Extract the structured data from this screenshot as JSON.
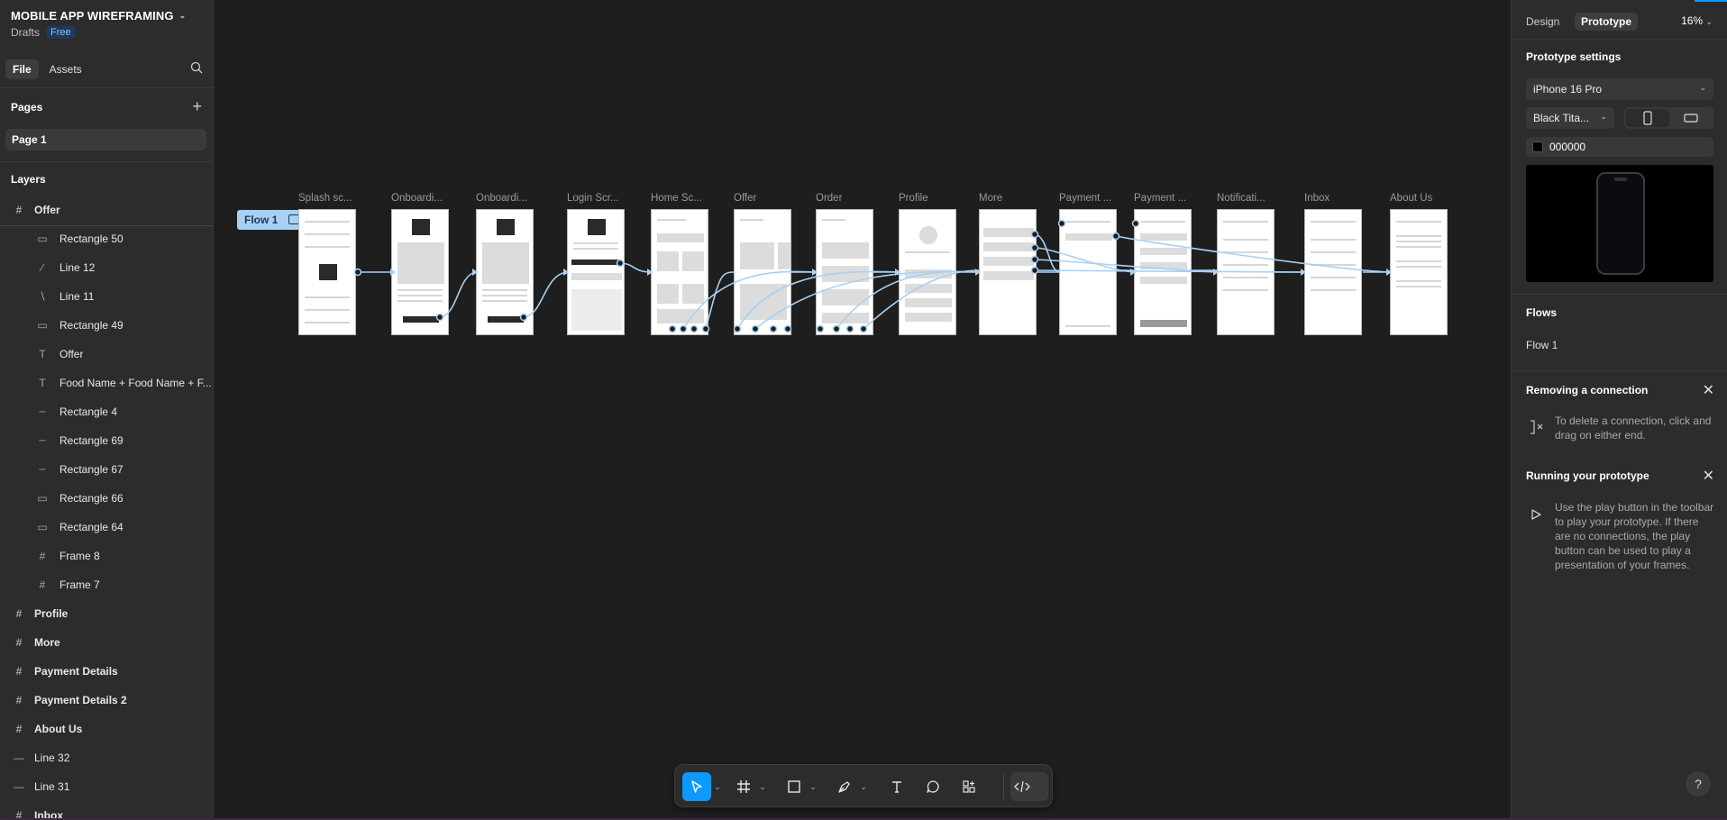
{
  "file": {
    "title": "MOBILE APP WIREFRAMING",
    "location": "Drafts",
    "plan": "Free"
  },
  "left_tabs": {
    "file": "File",
    "assets": "Assets"
  },
  "pages": {
    "title": "Pages",
    "items": [
      "Page 1"
    ]
  },
  "layers": {
    "title": "Layers",
    "items": [
      {
        "type": "frame",
        "level": 0,
        "label": "Offer"
      },
      {
        "type": "rect-dash",
        "level": 1,
        "label": "Rectangle 50"
      },
      {
        "type": "line",
        "level": 1,
        "label": "Line 12"
      },
      {
        "type": "line",
        "level": 1,
        "label": "Line 11"
      },
      {
        "type": "rect",
        "level": 1,
        "label": "Rectangle 49"
      },
      {
        "type": "text",
        "level": 1,
        "label": "Offer"
      },
      {
        "type": "text",
        "level": 1,
        "label": "Food Name + Food Name + F..."
      },
      {
        "type": "rect-dash",
        "level": 1,
        "label": "Rectangle 4"
      },
      {
        "type": "rect-dash",
        "level": 1,
        "label": "Rectangle 69"
      },
      {
        "type": "rect-dash",
        "level": 1,
        "label": "Rectangle 67"
      },
      {
        "type": "rect",
        "level": 1,
        "label": "Rectangle 66"
      },
      {
        "type": "rect",
        "level": 1,
        "label": "Rectangle 64"
      },
      {
        "type": "frame",
        "level": 1,
        "label": "Frame 8"
      },
      {
        "type": "frame",
        "level": 1,
        "label": "Frame 7"
      },
      {
        "type": "frame",
        "level": 0,
        "label": "Profile"
      },
      {
        "type": "frame",
        "level": 0,
        "label": "More"
      },
      {
        "type": "frame",
        "level": 0,
        "label": "Payment Details"
      },
      {
        "type": "frame",
        "level": 0,
        "label": "Payment Details 2"
      },
      {
        "type": "frame",
        "level": 0,
        "label": "About Us"
      },
      {
        "type": "line",
        "level": 0,
        "label": "Line 32"
      },
      {
        "type": "line",
        "level": 0,
        "label": "Line 31"
      },
      {
        "type": "frame",
        "level": 0,
        "label": "Inbox"
      }
    ]
  },
  "canvas": {
    "flow_tag": "Flow 1",
    "frames": [
      "Splash sc...",
      "Onboardi...",
      "Onboardi...",
      "Login Scr...",
      "Home Sc...",
      "Offer",
      "Order",
      "Profile",
      "More",
      "Payment ...",
      "Payment ...",
      "Notificati...",
      "Inbox",
      "About Us"
    ]
  },
  "toolbar": {
    "tools": [
      "move-tool",
      "frame-tool",
      "shape-tool",
      "pen-tool",
      "text-tool",
      "comment-tool",
      "actions-tool",
      "dev-mode-toggle"
    ]
  },
  "right": {
    "tabs": {
      "design": "Design",
      "prototype": "Prototype"
    },
    "zoom": "16%",
    "prototype_settings": "Prototype settings",
    "device": "iPhone 16 Pro",
    "model": "Black Tita...",
    "bg_color": "000000",
    "flows_title": "Flows",
    "flows": [
      "Flow 1"
    ],
    "removing": {
      "title": "Removing a connection",
      "text": "To delete a connection, click and drag on either end."
    },
    "running": {
      "title": "Running your prototype",
      "text": "Use the play button in the toolbar to play your prototype. If there are no connections, the play button can be used to play a presentation of your frames."
    },
    "help": "?"
  },
  "colors": {
    "accent": "#0d99ff",
    "connector": "#a8d0f5",
    "panel": "#2c2c2c",
    "canvas": "#1e1e1e"
  }
}
